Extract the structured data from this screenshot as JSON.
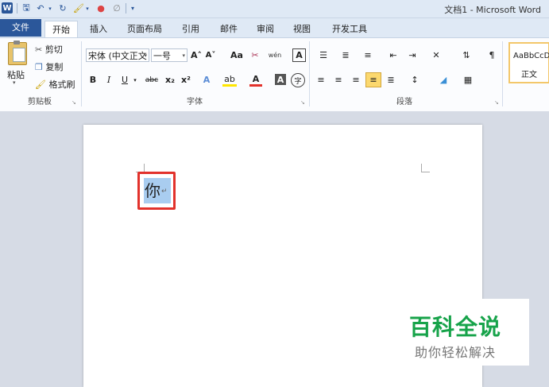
{
  "window": {
    "title": "文档1 - Microsoft Word",
    "app_icon": "W"
  },
  "quick_access": [
    "save-icon",
    "undo-icon",
    "redo-icon",
    "format-painter-icon",
    "color-icon",
    "clear-icon",
    "customize-icon"
  ],
  "tabs": [
    "文件",
    "开始",
    "插入",
    "页面布局",
    "引用",
    "邮件",
    "审阅",
    "视图",
    "开发工具"
  ],
  "active_tab": "开始",
  "clipboard": {
    "paste": "粘贴",
    "cut": "剪切",
    "copy": "复制",
    "format_painter": "格式刷",
    "group": "剪贴板"
  },
  "font": {
    "name": "宋体 (中文正文",
    "size": "一号",
    "group": "字体",
    "grow": "A˄",
    "shrink": "A˅",
    "change_case": "Aa",
    "clear_format": "✂",
    "pinyin": "wén",
    "border_char": "A",
    "bold": "B",
    "italic": "I",
    "underline": "U",
    "strike": "abc",
    "subscript": "x₂",
    "superscript": "x²",
    "text_effect": "A",
    "highlight": "ab",
    "font_color": "A",
    "shading": "A",
    "enclose": "字"
  },
  "paragraph": {
    "group": "段落"
  },
  "styles": {
    "sample": "AaBbCcD",
    "name": "正文"
  },
  "document": {
    "text": "你",
    "paragraph_mark": "↵"
  },
  "watermark": {
    "title": "百科全说",
    "subtitle": "助你轻松解决"
  },
  "colors": {
    "accent": "#2b579a",
    "highlight_box": "#e2322c",
    "selection": "#a9cdf0",
    "watermark_green": "#17a34a"
  }
}
